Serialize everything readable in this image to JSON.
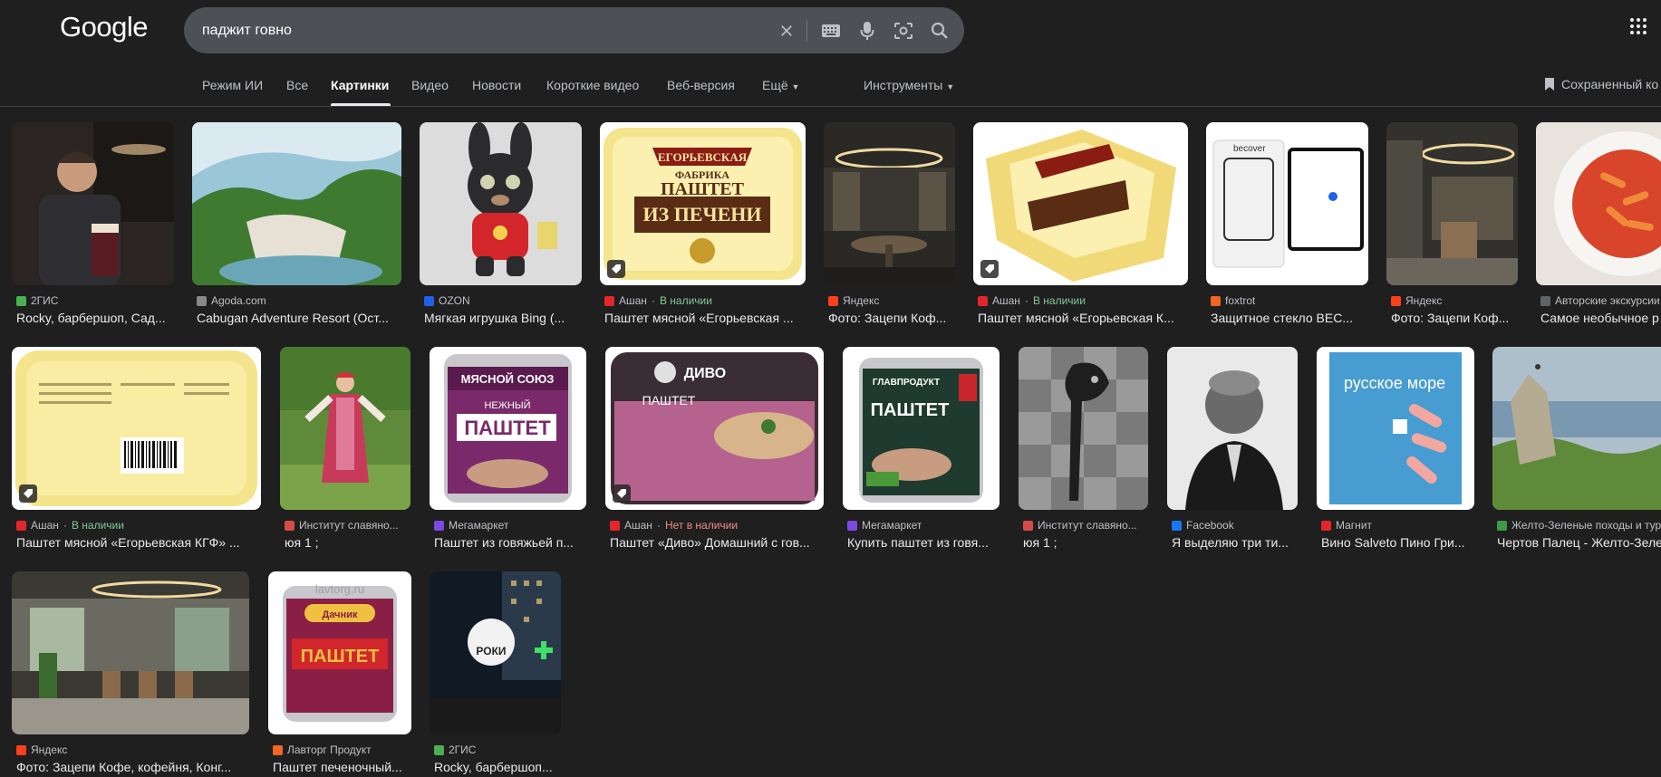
{
  "header": {
    "logo_text": "Google",
    "query": "паджит говно"
  },
  "tabs": [
    {
      "label": "Режим ИИ"
    },
    {
      "label": "Все"
    },
    {
      "label": "Картинки",
      "active": true
    },
    {
      "label": "Видео"
    },
    {
      "label": "Новости"
    },
    {
      "label": "Короткие видео"
    },
    {
      "label": "Веб-версия"
    },
    {
      "label": "Ещё"
    },
    {
      "label": "Инструменты"
    }
  ],
  "saved_label": "Сохраненный ко",
  "results": [
    {
      "source": "2ГИС",
      "title": "Rocky, барбершоп, Сад..."
    },
    {
      "source": "Agoda.com",
      "title": "Cabugan Adventure Resort (Ост..."
    },
    {
      "source": "OZON",
      "title": "Мягкая игрушка Bing (..."
    },
    {
      "source": "Ашан",
      "stock": "В наличии",
      "title": "Паштет мясной «Егорьевская ..."
    },
    {
      "source": "Яндекс",
      "title": "Фото: Зацепи Коф..."
    },
    {
      "source": "Ашан",
      "stock": "В наличии",
      "title": "Паштет мясной «Егорьевская К..."
    },
    {
      "source": "foxtrot",
      "title": "Защитное стекло BEC..."
    },
    {
      "source": "Яндекс",
      "title": "Фото: Зацепи Коф..."
    },
    {
      "source": "Авторские экскурсии",
      "title": "Самое необычное р"
    },
    {
      "source": "Ашан",
      "stock": "В наличии",
      "title": "Паштет мясной «Егорьевская КГФ» ..."
    },
    {
      "source": "Институт славяно...",
      "title": "юя 1 ;"
    },
    {
      "source": "Мегамаркет",
      "title": "Паштет из говяжьей п..."
    },
    {
      "source": "Ашан",
      "stock_out": "Нет в наличии",
      "title": "Паштет «Диво» Домашний с гов..."
    },
    {
      "source": "Мегамаркет",
      "title": "Купить паштет из говя..."
    },
    {
      "source": "Институт славяно...",
      "title": "юя 1 ;"
    },
    {
      "source": "Facebook",
      "title": "Я выделяю три ти..."
    },
    {
      "source": "Магнит",
      "title": "Вино Salveto Пино Гри..."
    },
    {
      "source": "Желто-Зеленые походы и тур",
      "title": "Чертов Палец - Желто-Зеле"
    },
    {
      "source": "Яндекс",
      "title": "Фото: Зацепи Кофе, кофейня, Конг..."
    },
    {
      "source": "Лавторг Продукт",
      "title": "Паштет печеночный..."
    },
    {
      "source": "2ГИС",
      "title": "Rocky, барбершоп..."
    }
  ],
  "image_text": {
    "pate_brand": "ЕГОРЬЕВСКАЯ",
    "pate_factory": "ФАБРИКА",
    "pate_name": "ПАШТЕТ",
    "pate_sub": "ИЗ ПЕЧЕНИ",
    "soyuz_brand": "МЯСНОЙ СОЮЗ",
    "soyuz_sub": "НЕЖНЫЙ",
    "divo_brand": "ДИВО",
    "glav_brand": "ГЛАВПРОДУКТ",
    "more_brand": "русское море",
    "dachnik_brand": "Дачник",
    "lavtorg_wm": "lavtorg.ru",
    "rocky_sign": "РОКИ",
    "becover": "becover"
  }
}
